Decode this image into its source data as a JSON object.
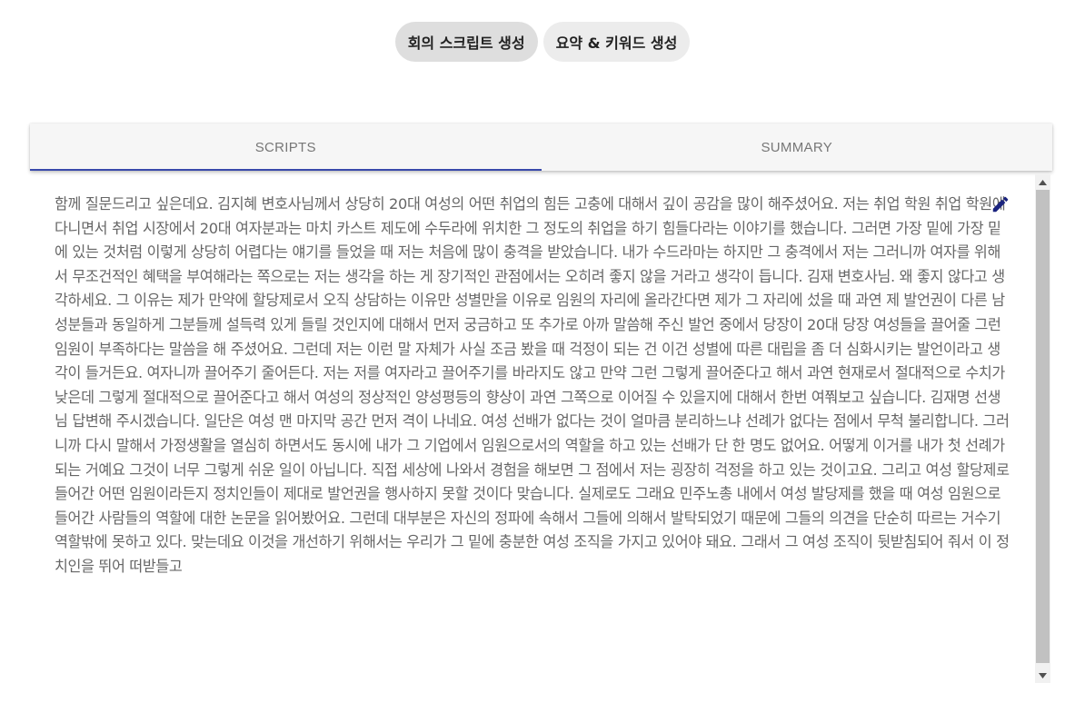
{
  "top_actions": {
    "script_button": "회의 스크립트 생성",
    "summary_button": "요약 & 키워드 생성"
  },
  "tabs": {
    "scripts": "SCRIPTS",
    "summary": "SUMMARY",
    "active": "scripts"
  },
  "script": {
    "text": "함께 질문드리고 싶은데요. 김지혜 변호사님께서 상당히 20대 여성의 어떤 취업의 힘든 고충에 대해서 깊이 공감을 많이 해주셨어요. 저는 취업 학원 취업 학원에 다니면서 취업 시장에서 20대 여자분과는 마치 카스트 제도에 수두라에 위치한 그 정도의 취업을 하기 힘들다라는 이야기를 했습니다. 그러면 가장 밑에 가장 밑에 있는 것처럼 이렇게 상당히 어렵다는 얘기를 들었을 때 저는 처음에 많이 충격을 받았습니다. 내가 수드라마는 하지만 그 충격에서 저는 그러니까 여자를 위해서 무조건적인 혜택을 부여해라는 쪽으로는 저는 생각을 하는 게 장기적인 관점에서는 오히려 좋지 않을 거라고 생각이 듭니다. 김재 변호사님. 왜 좋지 않다고 생각하세요. 그 이유는 제가 만약에 할당제로서 오직 상담하는 이유만 성별만을 이유로 임원의 자리에 올라간다면 제가 그 자리에 섰을 때 과연 제 발언권이 다른 남성분들과 동일하게 그분들께 설득력 있게 들릴 것인지에 대해서 먼저 궁금하고 또 추가로 아까 말씀해 주신 발언 중에서 당장이 20대 당장 여성들을 끌어줄 그런 임원이 부족하다는 말씀을 해 주셨어요. 그런데 저는 이런 말 자체가 사실 조금 봤을 때 걱정이 되는 건 이건 성별에 따른 대립을 좀 더 심화시키는 발언이라고 생각이 들거든요. 여자니까 끌어주기 줄어든다. 저는 저를 여자라고 끌어주기를 바라지도 않고 만약 그런 그렇게 끌어준다고 해서 과연 현재로서 절대적으로 수치가 낮은데 그렇게 절대적으로 끌어준다고 해서 여성의 정상적인 양성평등의 향상이 과연 그쪽으로 이어질 수 있을지에 대해서 한번 여쭤보고 싶습니다. 김재명 선생님 답변해 주시겠습니다. 일단은 여성 맨 마지막 공간 먼저 격이 나네요. 여성 선배가 없다는 것이 얼마큼 분리하느냐 선례가 없다는 점에서 무척 불리합니다. 그러니까 다시 말해서 가정생활을 열심히 하면서도 동시에 내가 그 기업에서 임원으로서의 역할을 하고 있는 선배가 단 한 명도 없어요. 어떻게 이거를 내가 첫 선례가 되는 거예요 그것이 너무 그렇게 쉬운 일이 아닙니다. 직접 세상에 나와서 경험을 해보면 그 점에서 저는 굉장히 걱정을 하고 있는 것이고요. 그리고 여성 할당제로 들어간 어떤 임원이라든지 정치인들이 제대로 발언권을 행사하지 못할 것이다 맞습니다. 실제로도 그래요 민주노총 내에서 여성 발당제를 했을 때 여성 임원으로 들어간 사람들의 역할에 대한 논문을 읽어봤어요. 그런데 대부분은 자신의 정파에 속해서 그들에 의해서 발탁되었기 때문에 그들의 의견을 단순히 따르는 거수기 역할밖에 못하고 있다. 맞는데요 이것을 개선하기 위해서는 우리가 그 밑에 충분한 여성 조직을 가지고 있어야 돼요. 그래서 그 여성 조직이 뒷받침되어 줘서 이 정치인을 뛰어 떠받들고"
  },
  "icons": {
    "edit": "pencil-icon",
    "scroll_up": "arrow-up-icon",
    "scroll_down": "arrow-down-icon"
  },
  "colors": {
    "tab_indicator": "#3949ab",
    "text": "#666666",
    "pill_active": "#dedede",
    "pill_inactive": "#ececec"
  }
}
